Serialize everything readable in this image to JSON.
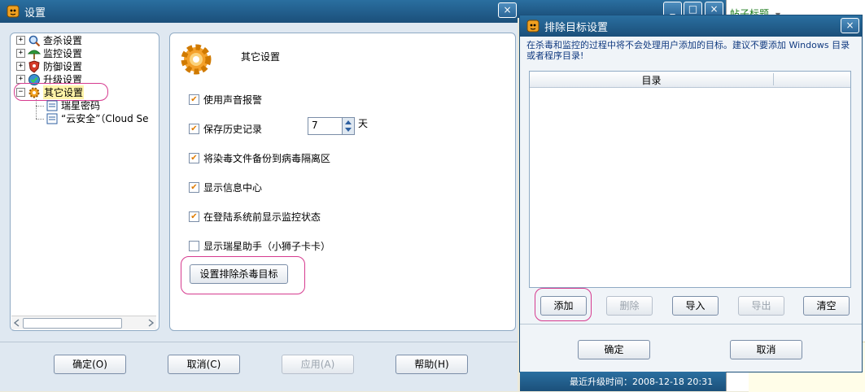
{
  "settings_window": {
    "title": "设置",
    "close_glyph": "×",
    "tree": [
      {
        "label": "查杀设置",
        "expander": "+",
        "icon": "scan-icon"
      },
      {
        "label": "监控设置",
        "expander": "+",
        "icon": "monitor-icon"
      },
      {
        "label": "防御设置",
        "expander": "+",
        "icon": "shield-icon"
      },
      {
        "label": "升级设置",
        "expander": "+",
        "icon": "upgrade-icon"
      },
      {
        "label": "其它设置",
        "expander": "−",
        "icon": "gear-icon",
        "selected": true
      },
      {
        "label": "瑞星密码",
        "icon": "document-icon"
      },
      {
        "label": "“云安全”（Cloud Se",
        "icon": "document-icon"
      }
    ],
    "section_title": "其它设置",
    "options": [
      {
        "label": "使用声音报警",
        "checked": true
      },
      {
        "label": "保存历史记录",
        "checked": true
      },
      {
        "label": "将染毒文件备份到病毒隔离区",
        "checked": true
      },
      {
        "label": "显示信息中心",
        "checked": true
      },
      {
        "label": "在登陆系统前显示监控状态",
        "checked": true
      },
      {
        "label": "显示瑞星助手（小狮子卡卡）",
        "checked": false
      }
    ],
    "history_days_value": "7",
    "history_days_unit": "天",
    "exclude_button": "设置排除杀毒目标",
    "buttons": {
      "ok": "确定(O)",
      "cancel": "取消(C)",
      "apply": "应用(A)",
      "help": "帮助(H)"
    }
  },
  "background_window": {
    "min_glyph": "_",
    "max_glyph": "□",
    "close_glyph": "×",
    "tab_label": "帖子标题",
    "tab_dropdown": "▼"
  },
  "exclude_dialog": {
    "title": "排除目标设置",
    "close_glyph": "×",
    "description": "在杀毒和监控的过程中将不会处理用户添加的目标。建议不要添加 Windows 目录或者程序目录!",
    "column_header": "目录",
    "buttons": {
      "add": "添加",
      "delete": "删除",
      "import": "导入",
      "export": "导出",
      "clear": "清空",
      "ok": "确定",
      "cancel": "取消"
    }
  },
  "status_bar": {
    "last_update": "最近升级时间：2008-12-18 20:31"
  },
  "colors": {
    "titlebar": "#1b4f7a",
    "highlight": "#d63b8f",
    "checkbox_mark": "#e07b00",
    "background": "#ece9d8"
  }
}
